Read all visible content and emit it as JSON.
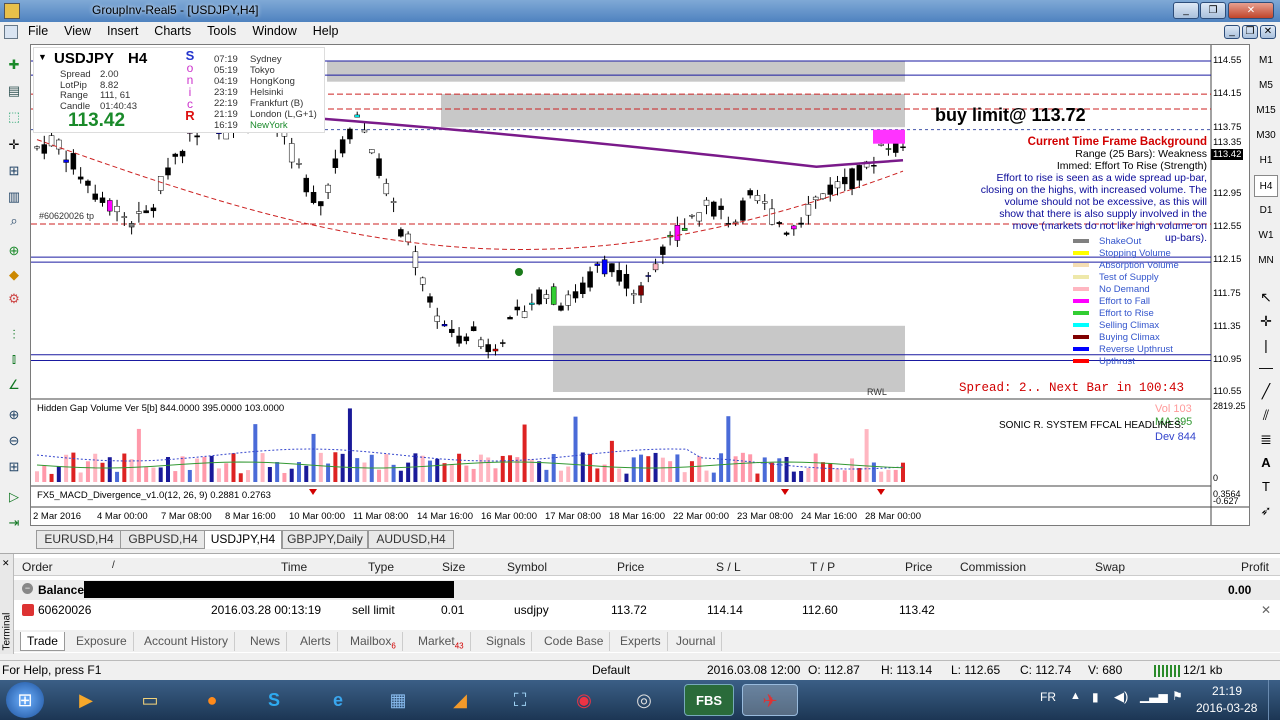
{
  "window": {
    "title": "GroupInv-Real5 - [USDJPY,H4]"
  },
  "menu": [
    "File",
    "View",
    "Insert",
    "Charts",
    "Tools",
    "Window",
    "Help"
  ],
  "timeframes": [
    "M1",
    "M5",
    "M15",
    "M30",
    "H1",
    "H4",
    "D1",
    "W1",
    "MN"
  ],
  "chart": {
    "symbol": "USDJPY",
    "timeframe": "H4",
    "info_labels": [
      "Spread",
      "LotPip",
      "Range",
      "Candle"
    ],
    "info_values": [
      "2.00",
      "8.82",
      "111, 61",
      "01:40:43"
    ],
    "big_price": "113.42",
    "sonic": [
      "S",
      "o",
      "n",
      "i",
      "c",
      "R"
    ],
    "sessions": [
      {
        "time": "07:19",
        "city": "Sydney"
      },
      {
        "time": "05:19",
        "city": "Tokyo"
      },
      {
        "time": "04:19",
        "city": "HongKong"
      },
      {
        "time": "23:19",
        "city": "Helsinki"
      },
      {
        "time": "22:19",
        "city": "Frankfurt  (B)"
      },
      {
        "time": "21:19",
        "city": "London  (L,G+1)"
      },
      {
        "time": "16:19",
        "city": "NewYork"
      }
    ],
    "order_tag": "#60620026 tp",
    "buy_limit_label": "buy limit@ 113.72",
    "background_title": "Current Time Frame Background",
    "background_lines": [
      "Range (25 Bars): Weakness",
      "Immed: Effort To Rise (Strength)",
      "Effort to rise is seen as a wide spread up-bar,",
      "closing on the highs, with increased volume. The",
      "volume should not be excessive, as this will",
      "show that there is also supply involved in the",
      "move (markets do not like high volume on",
      "up-bars)."
    ],
    "legend": [
      {
        "label": "ShakeOut",
        "color": "#808080"
      },
      {
        "label": "Stopping Volume",
        "color": "#ffff00"
      },
      {
        "label": "Absorption Volume",
        "color": "#f5deb3"
      },
      {
        "label": "Test of Supply",
        "color": "#eee8aa"
      },
      {
        "label": "No Demand",
        "color": "#ffb6c1"
      },
      {
        "label": "Effort to Fall",
        "color": "#ff00ff"
      },
      {
        "label": "Effort to Rise",
        "color": "#32cd32"
      },
      {
        "label": "Selling Climax",
        "color": "#00ffff"
      },
      {
        "label": "Buying Climax",
        "color": "#800000"
      },
      {
        "label": "Reverse Upthrust",
        "color": "#0000ff"
      },
      {
        "label": "Upthrust",
        "color": "#ff0000"
      }
    ],
    "price_axis": [
      "114.55",
      "114.15",
      "113.75",
      "113.35",
      "113.42",
      "112.95",
      "112.55",
      "112.15",
      "111.75",
      "111.35",
      "110.95",
      "110.55"
    ],
    "current_price_label": "113.42",
    "rwl_label": "RWL",
    "spread_text": "Spread: 2.. Next Bar in 100:43",
    "volume_panel": {
      "title": "Hidden Gap Volume Ver 5[b] 844.0000 395.0000 103.0000",
      "vol_label": "Vol  103",
      "ma_label": "MA  395",
      "dev_label": "Dev  844",
      "headline": "SONIC R. SYSTEM   FFCAL HEADLINES:",
      "axis_top": "2819.25",
      "axis_bottom": "0"
    },
    "macd_panel": {
      "title": "FX5_MACD_Divergence_v1.0(12, 26, 9) 0.2881 0.2763",
      "axis_top": "0.3564",
      "axis_bottom": "-0.627"
    },
    "time_axis": [
      "2 Mar 2016",
      "4 Mar 00:00",
      "7 Mar 08:00",
      "8 Mar 16:00",
      "10 Mar 00:00",
      "11 Mar 08:00",
      "14 Mar 16:00",
      "16 Mar 00:00",
      "17 Mar 08:00",
      "18 Mar 16:00",
      "22 Mar 00:00",
      "23 Mar 08:00",
      "24 Mar 16:00",
      "28 Mar 00:00"
    ]
  },
  "symbol_tabs": [
    "EURUSD,H4",
    "GBPUSD,H4",
    "USDJPY,H4",
    "GBPJPY,Daily",
    "AUDUSD,H4"
  ],
  "terminal": {
    "columns": [
      "Order",
      "/",
      "Time",
      "Type",
      "Size",
      "Symbol",
      "Price",
      "S / L",
      "T / P",
      "Price",
      "Commission",
      "Swap",
      "Profit"
    ],
    "balance_label": "Balance:",
    "balance_profit": "0.00",
    "row": {
      "order": "60620026",
      "time": "2016.03.28 00:13:19",
      "type": "sell limit",
      "size": "0.01",
      "symbol": "usdjpy",
      "price": "113.72",
      "sl": "114.14",
      "tp": "112.60",
      "cur_price": "113.42"
    },
    "side_label": "Terminal",
    "tabs": [
      {
        "label": "Trade",
        "badge": ""
      },
      {
        "label": "Exposure",
        "badge": ""
      },
      {
        "label": "Account History",
        "badge": ""
      },
      {
        "label": "News",
        "badge": ""
      },
      {
        "label": "Alerts",
        "badge": ""
      },
      {
        "label": "Mailbox",
        "badge": "6"
      },
      {
        "label": "Market",
        "badge": "43"
      },
      {
        "label": "Signals",
        "badge": ""
      },
      {
        "label": "Code Base",
        "badge": ""
      },
      {
        "label": "Experts",
        "badge": ""
      },
      {
        "label": "Journal",
        "badge": ""
      }
    ]
  },
  "status": {
    "help": "For Help, press F1",
    "profile": "Default",
    "datetime": "2016.03.08 12:00",
    "open": "O: 112.87",
    "high": "H: 113.14",
    "low": "L: 112.65",
    "close": "C: 112.74",
    "volume": "V: 680",
    "traffic": "12/1 kb"
  },
  "taskbar": {
    "lang": "FR",
    "time": "21:19",
    "date": "2016-03-28",
    "fbs": "FBS"
  }
}
